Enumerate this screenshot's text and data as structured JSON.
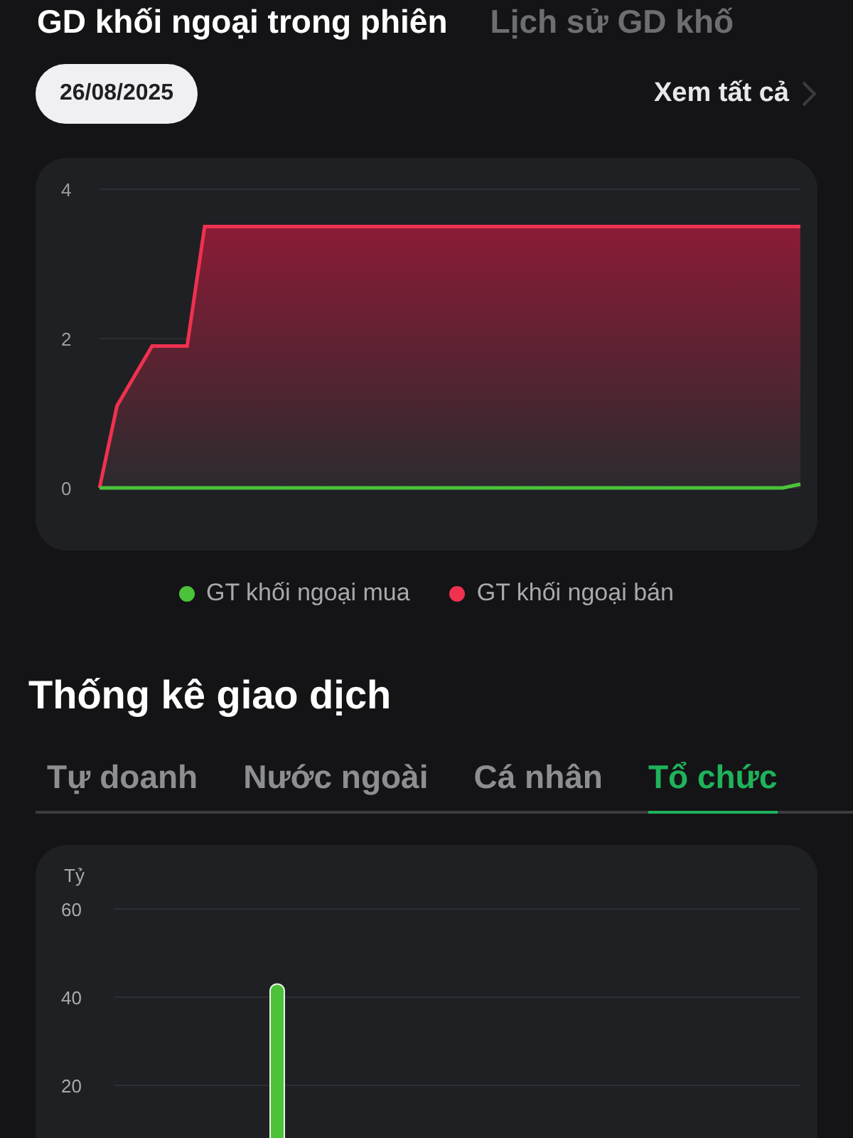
{
  "header_tabs": [
    {
      "label": "GD khối ngoại trong phiên",
      "selected": true
    },
    {
      "label": "Lịch sử GD khố",
      "selected": false
    }
  ],
  "date_filter": {
    "value": "26/08/2025"
  },
  "view_all": {
    "label": "Xem tất cả"
  },
  "foreign_chart": {
    "chart_data": {
      "type": "area",
      "categories": [
        null,
        null,
        null,
        null,
        null,
        null,
        null,
        null,
        null,
        null,
        null,
        null,
        null,
        null,
        null,
        null,
        null,
        null,
        null,
        null,
        null,
        null,
        null,
        null,
        null,
        null,
        null,
        null,
        null,
        null,
        null,
        null,
        null,
        null,
        null,
        null,
        null,
        null,
        null,
        null,
        null
      ],
      "ylim": [
        0,
        4
      ],
      "yticks": [
        0,
        2,
        4
      ],
      "series": [
        {
          "name": "GT khối ngoại mua",
          "color": "#4cc23a",
          "values": [
            0,
            0,
            0,
            0,
            0,
            0,
            0,
            0,
            0,
            0,
            0,
            0,
            0,
            0,
            0,
            0,
            0,
            0,
            0,
            0,
            0,
            0,
            0,
            0,
            0,
            0,
            0,
            0,
            0,
            0,
            0,
            0,
            0,
            0,
            0,
            0,
            0,
            0,
            0,
            0,
            0.05
          ]
        },
        {
          "name": "GT khối ngoại bán",
          "color": "#f0314f",
          "values": [
            0,
            1.1,
            1.5,
            1.9,
            1.9,
            1.9,
            3.5,
            3.5,
            3.5,
            3.5,
            3.5,
            3.5,
            3.5,
            3.5,
            3.5,
            3.5,
            3.5,
            3.5,
            3.5,
            3.5,
            3.5,
            3.5,
            3.5,
            3.5,
            3.5,
            3.5,
            3.5,
            3.5,
            3.5,
            3.5,
            3.5,
            3.5,
            3.5,
            3.5,
            3.5,
            3.5,
            3.5,
            3.5,
            3.5,
            3.5,
            3.5
          ]
        }
      ]
    }
  },
  "stats": {
    "title": "Thống kê giao dịch",
    "tabs": [
      {
        "label": "Tự doanh",
        "selected": false
      },
      {
        "label": "Nước ngoài",
        "selected": false
      },
      {
        "label": "Cá nhân",
        "selected": false
      },
      {
        "label": "Tổ chức",
        "selected": true
      }
    ],
    "chart_data": {
      "type": "bar",
      "ylabel": "Tỷ",
      "ylim": [
        0,
        60
      ],
      "yticks": [
        20,
        40,
        60
      ],
      "categories": [
        null
      ],
      "values": [
        43
      ]
    }
  }
}
